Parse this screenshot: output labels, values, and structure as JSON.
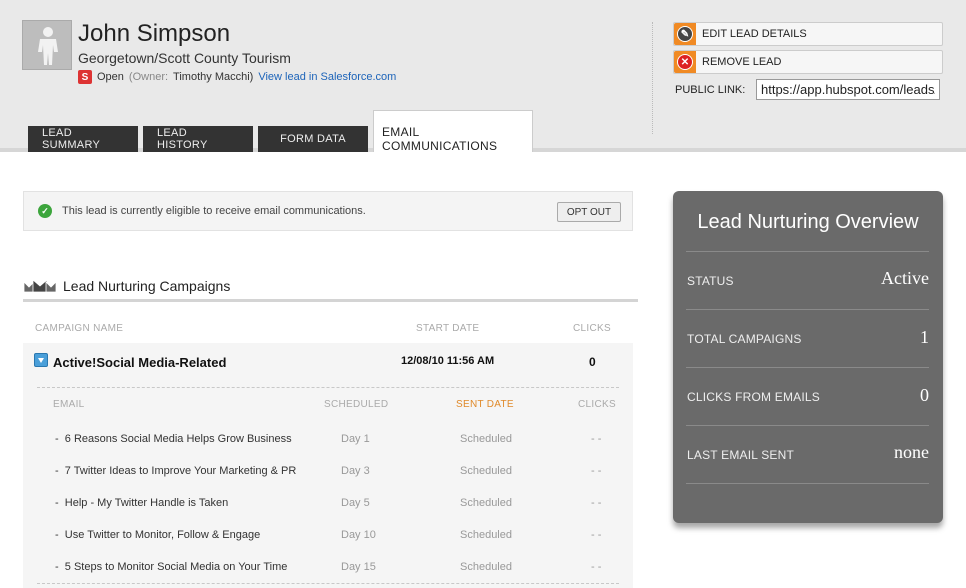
{
  "lead": {
    "name": "John Simpson",
    "company": "Georgetown/Scott County Tourism",
    "status": "Open",
    "owner_prefix": "(Owner:",
    "owner_name": "Timothy Macchi)",
    "salesforce_link": "View lead in Salesforce.com"
  },
  "tabs": [
    {
      "label": "LEAD SUMMARY"
    },
    {
      "label": "LEAD HISTORY"
    },
    {
      "label": "FORM DATA"
    },
    {
      "label": "EMAIL COMMUNICATIONS"
    }
  ],
  "actions": {
    "edit_label": "EDIT LEAD DETAILS",
    "remove_label": "REMOVE LEAD",
    "public_link_label": "PUBLIC LINK:",
    "public_link_value": "https://app.hubspot.com/leads/public"
  },
  "eligibility": {
    "text": "This lead is currently eligible to receive email communications.",
    "opt_out_label": "OPT OUT"
  },
  "campaigns": {
    "title": "Lead Nurturing Campaigns",
    "columns": {
      "name": "CAMPAIGN NAME",
      "start": "START DATE",
      "clicks": "CLICKS"
    },
    "campaign": {
      "name": "Active!Social Media-Related",
      "start_date": "12/08/10 11:56 AM",
      "clicks": "0"
    },
    "email_columns": {
      "email": "EMAIL",
      "scheduled": "SCHEDULED",
      "sent": "SENT DATE",
      "clicks": "CLICKS"
    },
    "emails": [
      {
        "name": "6 Reasons Social Media Helps Grow Business",
        "day": "Day 1",
        "sent": "Scheduled",
        "clicks": "- -"
      },
      {
        "name": "7 Twitter Ideas to Improve Your Marketing & PR",
        "day": "Day 3",
        "sent": "Scheduled",
        "clicks": "- -"
      },
      {
        "name": "Help - My Twitter Handle is Taken",
        "day": "Day 5",
        "sent": "Scheduled",
        "clicks": "- -"
      },
      {
        "name": "Use Twitter to Monitor, Follow & Engage",
        "day": "Day 10",
        "sent": "Scheduled",
        "clicks": "- -"
      },
      {
        "name": "5 Steps to Monitor Social Media on Your Time",
        "day": "Day 15",
        "sent": "Scheduled",
        "clicks": "- -"
      }
    ]
  },
  "overview": {
    "title": "Lead Nurturing Overview",
    "rows": [
      {
        "label": "STATUS",
        "value": "Active"
      },
      {
        "label": "TOTAL CAMPAIGNS",
        "value": "1"
      },
      {
        "label": "CLICKS FROM EMAILS",
        "value": "0"
      },
      {
        "label": "LAST EMAIL SENT",
        "value": "none"
      }
    ]
  },
  "colors": {
    "accent_orange": "#f08a24",
    "tab_dark": "#333333",
    "panel_gray": "#6a6a6a",
    "sent_date_header": "#e08a2a",
    "link_blue": "#1d64b9"
  }
}
